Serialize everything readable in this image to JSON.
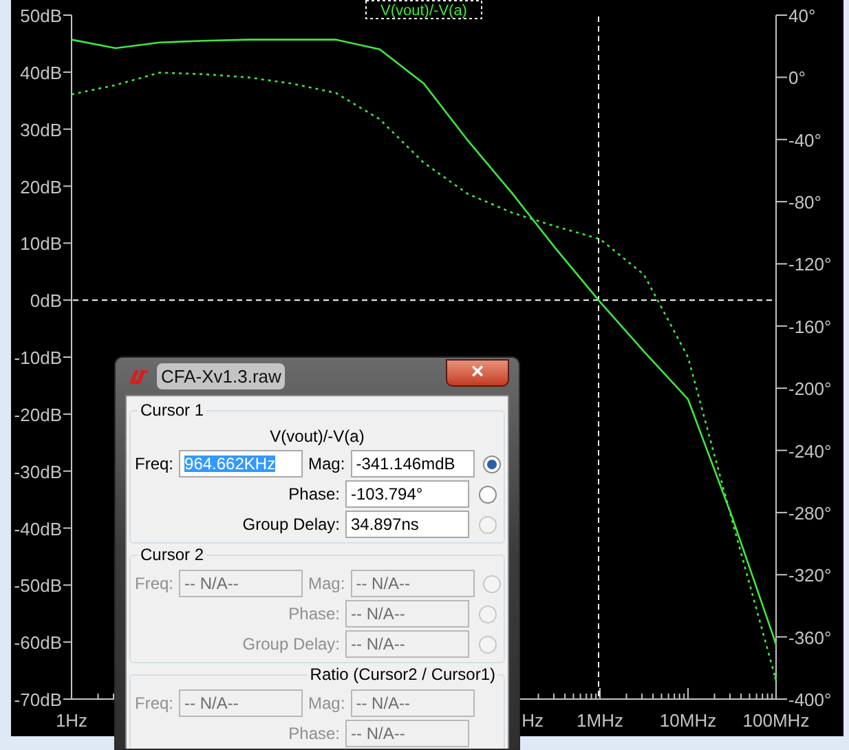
{
  "plot": {
    "trace_label": "V(vout)/-V(a)",
    "partial_axis_label": "Hz",
    "chart_data": {
      "type": "line",
      "categories": [
        "1Hz",
        null,
        null,
        null,
        null,
        null,
        null,
        null,
        null,
        null,
        null,
        null,
        "1MHz",
        null,
        "10MHz",
        null,
        "100MHz"
      ],
      "ylim": [
        -70,
        50
      ],
      "yticks": [
        {
          "value": 50,
          "label": "50dB"
        },
        {
          "value": 40,
          "label": "40dB"
        },
        {
          "value": 30,
          "label": "30dB"
        },
        {
          "value": 20,
          "label": "20dB"
        },
        {
          "value": 10,
          "label": "10dB"
        },
        {
          "value": 0,
          "label": "0dB"
        },
        {
          "value": -10,
          "label": "-10dB"
        },
        {
          "value": -20,
          "label": "-20dB"
        },
        {
          "value": -30,
          "label": "-30dB"
        },
        {
          "value": -40,
          "label": "-40dB"
        },
        {
          "value": -50,
          "label": "-50dB"
        },
        {
          "value": -60,
          "label": "-60dB"
        },
        {
          "value": -70,
          "label": "-70dB"
        }
      ],
      "y2lim": [
        -400,
        40
      ],
      "y2ticks": [
        {
          "value": 40,
          "label": "40°"
        },
        {
          "value": 0,
          "label": "0°"
        },
        {
          "value": -40,
          "label": "-40°"
        },
        {
          "value": -80,
          "label": "-80°"
        },
        {
          "value": -120,
          "label": "-120°"
        },
        {
          "value": -160,
          "label": "-160°"
        },
        {
          "value": -200,
          "label": "-200°"
        },
        {
          "value": -240,
          "label": "-240°"
        },
        {
          "value": -280,
          "label": "-280°"
        },
        {
          "value": -320,
          "label": "-320°"
        },
        {
          "value": -360,
          "label": "-360°"
        },
        {
          "value": -400,
          "label": "-400°"
        }
      ],
      "series": [
        {
          "color": "#3ee83e",
          "line_style": "solid",
          "values": [
            45.7,
            44.2,
            45.2,
            45.5,
            45.7,
            45.7,
            45.7,
            44,
            38,
            28,
            18.8,
            9,
            -0.3,
            -9,
            -17.4,
            -38,
            -60.4
          ]
        },
        {
          "color": "#3ee83e",
          "line_style": "dotted",
          "axis": "y2",
          "values": [
            -11,
            -5,
            3,
            2,
            0,
            -4,
            -10,
            -27,
            -55,
            -75,
            -87,
            -96,
            -104,
            -127,
            -180,
            -285,
            -388
          ]
        }
      ]
    }
  },
  "dialog": {
    "title": "CFA-Xv1.3.raw",
    "close": "×",
    "groups": [
      {
        "kind": "cursor",
        "legend": "Cursor 1",
        "disabled": false,
        "trace": "V(vout)/-V(a)",
        "freq": {
          "label": "Freq:",
          "value": "964.662KHz",
          "text_selected": true
        },
        "rows": [
          {
            "label": "Mag:",
            "value": "-341.146mdB",
            "radio": {
              "selected": true,
              "disabled": false
            }
          },
          {
            "label": "Phase:",
            "value": "-103.794°",
            "radio": {
              "selected": false,
              "disabled": false
            }
          },
          {
            "label": "Group Delay:",
            "value": "34.897ns",
            "radio": {
              "selected": false,
              "disabled": true
            }
          }
        ]
      },
      {
        "kind": "cursor",
        "legend": "Cursor 2",
        "disabled": true,
        "freq": {
          "label": "Freq:",
          "value": "-- N/A--",
          "text_selected": false
        },
        "rows": [
          {
            "label": "Mag:",
            "value": "-- N/A--",
            "radio": {
              "selected": false,
              "disabled": true
            }
          },
          {
            "label": "Phase:",
            "value": "-- N/A--",
            "radio": {
              "selected": false,
              "disabled": true
            }
          },
          {
            "label": "Group Delay:",
            "value": "-- N/A--",
            "radio": {
              "selected": false,
              "disabled": true
            }
          }
        ]
      },
      {
        "kind": "ratio",
        "legend": "Ratio (Cursor2 / Cursor1)",
        "disabled": true,
        "freq": {
          "label": "Freq:",
          "value": "-- N/A--",
          "text_selected": false
        },
        "rows": [
          {
            "label": "Mag:",
            "value": "-- N/A--"
          },
          {
            "label": "Phase:",
            "value": "-- N/A--"
          }
        ]
      }
    ]
  }
}
